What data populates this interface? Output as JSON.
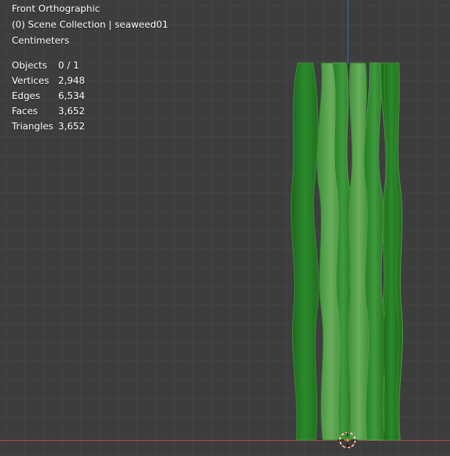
{
  "viewport": {
    "view_name": "Front Orthographic",
    "collection_info": "(0) Scene Collection | seaweed01",
    "units": "Centimeters"
  },
  "stats": [
    {
      "label": "Objects",
      "value": "0 / 1"
    },
    {
      "label": "Vertices",
      "value": "2,948"
    },
    {
      "label": "Edges",
      "value": "6,534"
    },
    {
      "label": "Faces",
      "value": "3,652"
    },
    {
      "label": "Triangles",
      "value": "3,652"
    }
  ],
  "colors": {
    "background": "#3d3d3d",
    "grid": "#464646",
    "x_axis": "#c9434d",
    "z_axis": "#3d6ee0",
    "seaweed_dark": "#1f6e1f",
    "seaweed_mid": "#2e8b2e",
    "seaweed_light": "#5aa84f",
    "cursor": "#ffffff",
    "cursor_accent": "#d6452f"
  },
  "icons": [
    "3d-cursor-icon"
  ]
}
